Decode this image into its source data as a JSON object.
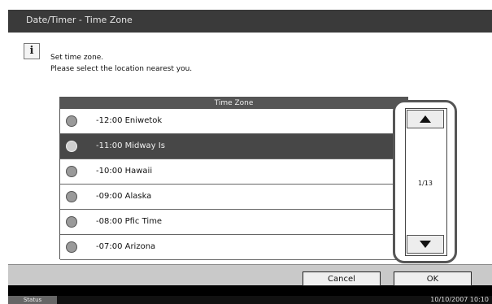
{
  "window": {
    "title": "Date/Timer - Time Zone"
  },
  "message": {
    "line1": "Set time zone.",
    "line2": "Please select the location nearest you."
  },
  "list": {
    "header": "Time Zone",
    "rows": [
      {
        "label": "-12:00 Eniwetok",
        "selected": false
      },
      {
        "label": "-11:00 Midway Is",
        "selected": true
      },
      {
        "label": "-10:00 Hawaii",
        "selected": false
      },
      {
        "label": "-09:00 Alaska",
        "selected": false
      },
      {
        "label": "-08:00 Pfic Time",
        "selected": false
      },
      {
        "label": "-07:00 Arizona",
        "selected": false
      }
    ]
  },
  "pager": {
    "indicator": "1/13",
    "up_icon": "triangle-up",
    "down_icon": "triangle-down"
  },
  "buttons": {
    "cancel": "Cancel",
    "ok": "OK"
  },
  "status": {
    "label": "Status",
    "datetime": "10/10/2007  10:10"
  },
  "icons": {
    "info": "i",
    "row_icon": "globe-icon"
  }
}
